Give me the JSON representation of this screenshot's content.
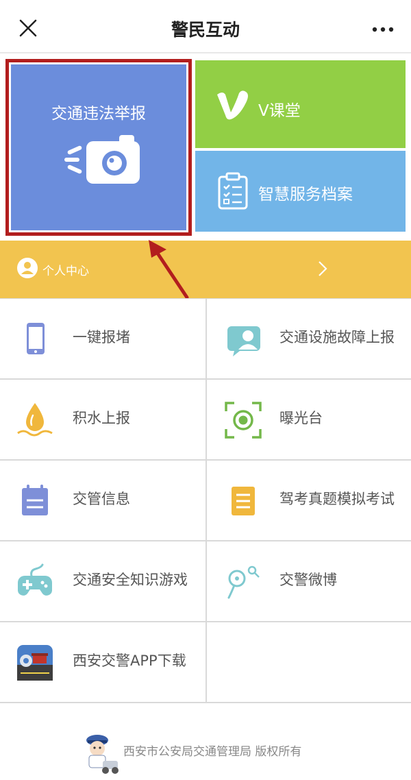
{
  "header": {
    "title": "警民互动",
    "close_icon": "close-icon",
    "more_icon": "more-icon"
  },
  "tiles": {
    "report": {
      "label": "交通违法举报",
      "icon": "camera-icon",
      "color": "#6b8ddc",
      "highlight_color": "#b21e1e"
    },
    "vclass": {
      "label": "V课堂",
      "icon": "v-logo-icon",
      "color": "#92cf45"
    },
    "archive": {
      "label": "智慧服务档案",
      "icon": "clipboard-icon",
      "color": "#72b5e8"
    }
  },
  "personal_center": {
    "label": "个人中心",
    "icon": "user-icon",
    "color": "#f2c44f"
  },
  "services": [
    {
      "label": "一键报堵",
      "icon": "phone-icon"
    },
    {
      "label": "交通设施故障上报",
      "icon": "chat-bubble-icon"
    },
    {
      "label": "积水上报",
      "icon": "water-drop-icon"
    },
    {
      "label": "曝光台",
      "icon": "focus-target-icon"
    },
    {
      "label": "交管信息",
      "icon": "notepad-icon"
    },
    {
      "label": "驾考真题模拟考试",
      "icon": "document-icon"
    },
    {
      "label": "交通安全知识游戏",
      "icon": "gamepad-icon"
    },
    {
      "label": "交警微博",
      "icon": "weibo-icon"
    },
    {
      "label": "西安交警APP下载",
      "icon": "app-logo-icon"
    }
  ],
  "footer": {
    "text": "西安市公安局交通管理局  版权所有",
    "mascot_icon": "police-mascot-icon"
  }
}
